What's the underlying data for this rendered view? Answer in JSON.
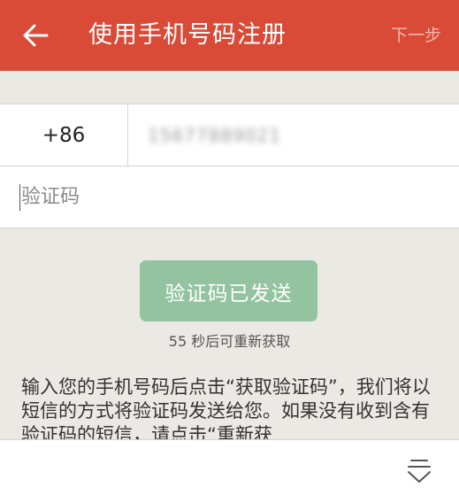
{
  "app_bar": {
    "title": "使用手机号码注册",
    "next_label": "下一步",
    "background_color": "#d94a37"
  },
  "phone": {
    "country_code": "+86",
    "number": "15677889021"
  },
  "verification": {
    "placeholder": "验证码",
    "value": ""
  },
  "send_button": {
    "label": "验证码已发送",
    "color": "#93c49f"
  },
  "countdown": {
    "text": "55 秒后可重新获取"
  },
  "instructions": {
    "text": "输入您的手机号码后点击“获取验证码”，我们将以短信的方式将验证码发送给您。如果没有收到含有验证码的短信，请点击“重新获"
  },
  "icons": {
    "back": "arrow-left-icon",
    "expand": "expand-down-icon"
  }
}
